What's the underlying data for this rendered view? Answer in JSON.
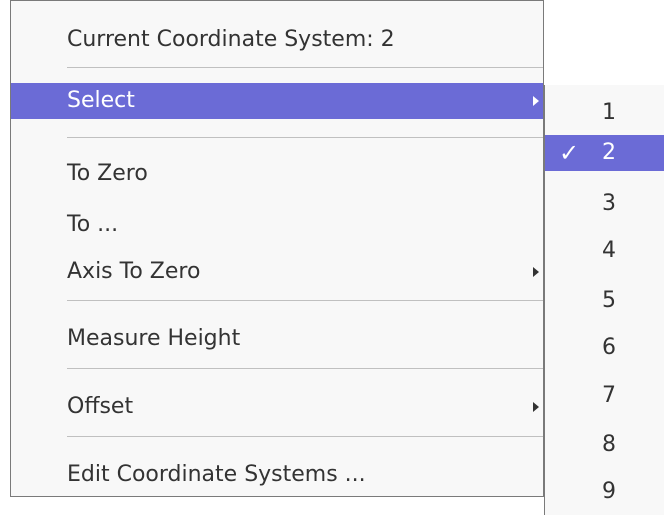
{
  "menu": {
    "header": "Current Coordinate System: 2",
    "items": [
      {
        "label": "Select",
        "has_submenu": true,
        "highlighted": true
      },
      {
        "label": "To Zero",
        "has_submenu": false
      },
      {
        "label": "To ...",
        "has_submenu": false
      },
      {
        "label": "Axis To Zero",
        "has_submenu": true
      },
      {
        "label": "Measure Height",
        "has_submenu": false
      },
      {
        "label": "Offset",
        "has_submenu": true
      },
      {
        "label": "Edit Coordinate Systems ...",
        "has_submenu": false
      }
    ]
  },
  "submenu": {
    "items": [
      {
        "label": "1"
      },
      {
        "label": "2",
        "checked": true,
        "highlighted": true
      },
      {
        "label": "3"
      },
      {
        "label": "4"
      },
      {
        "label": "5"
      },
      {
        "label": "6"
      },
      {
        "label": "7"
      },
      {
        "label": "8"
      },
      {
        "label": "9"
      }
    ],
    "check_mark": "✓"
  },
  "colors": {
    "highlight": "#6b6bd6",
    "text": "#333333",
    "background": "#f8f8f8",
    "separator": "#c0c0c0"
  }
}
